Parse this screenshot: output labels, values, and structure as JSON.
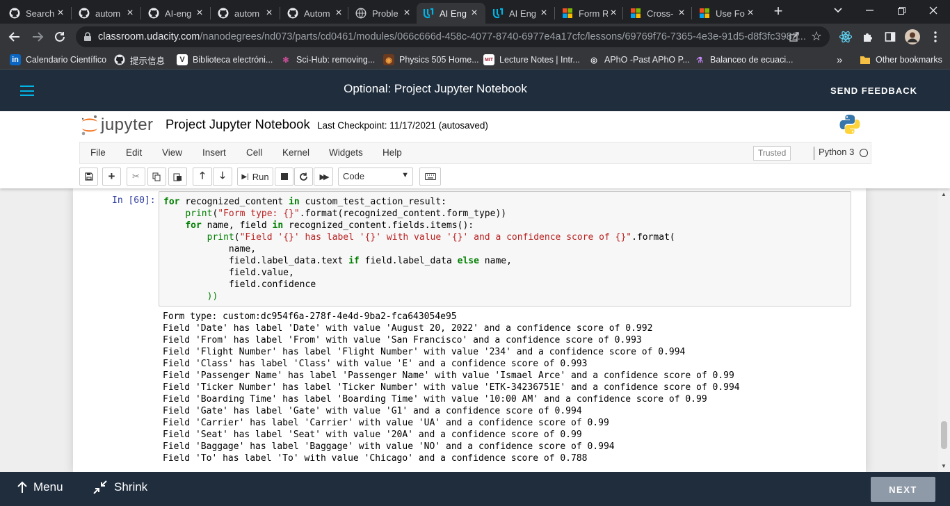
{
  "browser": {
    "tabs": [
      {
        "title": "Search",
        "icon": "github-icon"
      },
      {
        "title": "autom",
        "icon": "github-icon"
      },
      {
        "title": "AI-eng",
        "icon": "github-icon"
      },
      {
        "title": "autom",
        "icon": "github-icon"
      },
      {
        "title": "Autom",
        "icon": "github-icon"
      },
      {
        "title": "Proble",
        "icon": "globe-icon"
      },
      {
        "title": "AI Eng",
        "icon": "udacity-icon",
        "active": true
      },
      {
        "title": "AI Eng",
        "icon": "udacity-icon"
      },
      {
        "title": "Form R",
        "icon": "microsoft-icon"
      },
      {
        "title": "Cross-",
        "icon": "microsoft-icon"
      },
      {
        "title": "Use Fo",
        "icon": "microsoft-icon"
      }
    ],
    "url_host": "classroom.udacity.com",
    "url_path": "/nanodegrees/nd073/parts/cd0461/modules/066c666d-458c-4077-8740-6977e4a17cfc/lessons/69769f76-7365-4e3e-91d5-d8f3fc3982...",
    "bookmarks": [
      {
        "label": "Calendario Científico",
        "icon": "linkedin-icon"
      },
      {
        "label": "提示信息",
        "icon": "github-icon"
      },
      {
        "label": "Biblioteca electróni...",
        "icon": "v-icon"
      },
      {
        "label": "Sci-Hub: removing...",
        "icon": "scihub-icon"
      },
      {
        "label": "Physics 505 Home...",
        "icon": "physics-icon"
      },
      {
        "label": "Lecture Notes | Intr...",
        "icon": "mit-icon"
      },
      {
        "label": "APhO -Past APhO P...",
        "icon": "globe-icon"
      },
      {
        "label": "Balanceo de ecuaci...",
        "icon": "flask-icon"
      }
    ],
    "other_bookmarks": "Other bookmarks",
    "overflow": "»"
  },
  "udacity": {
    "title": "Optional: Project Jupyter Notebook",
    "feedback": "SEND FEEDBACK",
    "menu": "Menu",
    "shrink": "Shrink",
    "next": "NEXT"
  },
  "jupyter": {
    "wordmark": "jupyter",
    "notebook_name": "Project Jupyter Notebook",
    "checkpoint": "Last Checkpoint: 11/17/2021  (autosaved)",
    "menus": [
      "File",
      "Edit",
      "View",
      "Insert",
      "Cell",
      "Kernel",
      "Widgets",
      "Help"
    ],
    "trusted": "Trusted",
    "kernel": "Python 3",
    "run_label": "Run",
    "cell_type": "Code"
  },
  "cell": {
    "prompt": "In [60]:",
    "code": [
      "for recognized_content in custom_test_action_result:",
      "    print(\"Form type: {}\".format(recognized_content.form_type))",
      "    for name, field in recognized_content.fields.items():",
      "        print(\"Field '{}' has label '{}' with value '{}' and a confidence score of {}\".format(",
      "            name,",
      "            field.label_data.text if field.label_data else name,",
      "            field.value,",
      "            field.confidence",
      "        ))"
    ],
    "output": [
      "Form type: custom:dc954f6a-278f-4e4d-9ba2-fca643054e95",
      "Field 'Date' has label 'Date' with value 'August 20, 2022' and a confidence score of 0.992",
      "Field 'From' has label 'From' with value 'San Francisco' and a confidence score of 0.993",
      "Field 'Flight Number' has label 'Flight Number' with value '234' and a confidence score of 0.994",
      "Field 'Class' has label 'Class' with value 'E' and a confidence score of 0.993",
      "Field 'Passenger Name' has label 'Passenger Name' with value 'Ismael Arce' and a confidence score of 0.99",
      "Field 'Ticker Number' has label 'Ticker Number' with value 'ETK-34236751E' and a confidence score of 0.994",
      "Field 'Boarding Time' has label 'Boarding Time' with value '10:00 AM' and a confidence score of 0.99",
      "Field 'Gate' has label 'Gate' with value 'G1' and a confidence score of 0.994",
      "Field 'Carrier' has label 'Carrier' with value 'UA' and a confidence score of 0.99",
      "Field 'Seat' has label 'Seat' with value '20A' and a confidence score of 0.99",
      "Field 'Baggage' has label 'Baggage' with value 'NO' and a confidence score of 0.994",
      "Field 'To' has label 'To' with value 'Chicago' and a confidence score of 0.788"
    ]
  },
  "colors": {
    "udacity_header": "#1f2d3d",
    "udacity_accent": "#02b3e4",
    "prompt_blue": "#303f9f",
    "keyword_green": "#008000",
    "string_red": "#ba2121"
  }
}
